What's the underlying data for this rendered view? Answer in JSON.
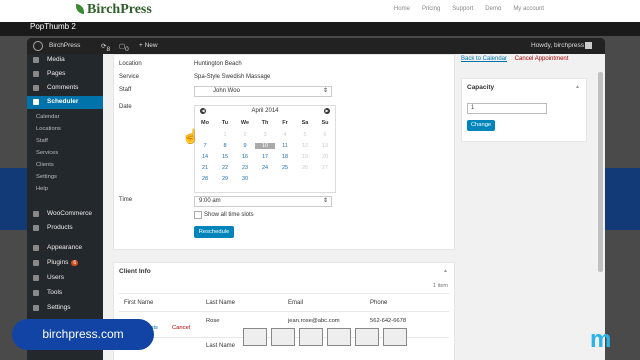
{
  "site": {
    "logo": "BirchPress",
    "nav": [
      "Home",
      "Pricing",
      "Support",
      "Demo",
      "My account"
    ]
  },
  "video_title": "PopThumb 2",
  "admin_bar": {
    "site_name": "BirchPress",
    "updates": "8",
    "comments": "0",
    "new_label": "+ New",
    "howdy": "Howdy, birchpress"
  },
  "menu": {
    "items": [
      {
        "label": "Media",
        "icon": "media-icon"
      },
      {
        "label": "Pages",
        "icon": "pages-icon"
      },
      {
        "label": "Comments",
        "icon": "comments-icon"
      },
      {
        "label": "Scheduler",
        "icon": "calendar-icon"
      }
    ],
    "submenu": [
      "Calendar",
      "Locations",
      "Staff",
      "Services",
      "Clients",
      "Settings",
      "Help"
    ],
    "items2": [
      {
        "label": "WooCommerce",
        "icon": "woo-icon"
      },
      {
        "label": "Products",
        "icon": "products-icon"
      },
      {
        "label": "Appearance",
        "icon": "appearance-icon"
      },
      {
        "label": "Plugins",
        "icon": "plugins-icon"
      },
      {
        "label": "Users",
        "icon": "users-icon"
      },
      {
        "label": "Tools",
        "icon": "tools-icon"
      },
      {
        "label": "Settings",
        "icon": "settings-icon"
      }
    ],
    "plugins_badge": "6"
  },
  "form": {
    "location_label": "Location",
    "location_value": "Huntington Beach",
    "service_label": "Service",
    "service_value": "Spa-Style Swedish Massage",
    "staff_label": "Staff",
    "staff_value": "John Woo",
    "date_label": "Date",
    "time_label": "Time",
    "time_value": "9:00 am",
    "all_slots_label": "Show all time slots",
    "reschedule_label": "Reschedule"
  },
  "calendar": {
    "title": "April 2014",
    "day_names": [
      "Mo",
      "Tu",
      "We",
      "Th",
      "Fr",
      "Sa",
      "Su"
    ],
    "weeks": [
      [
        "",
        "1",
        "2",
        "3",
        "4",
        "5",
        "6"
      ],
      [
        "7",
        "8",
        "9",
        "10",
        "11",
        "12",
        "13"
      ],
      [
        "14",
        "15",
        "16",
        "17",
        "18",
        "19",
        "20"
      ],
      [
        "21",
        "22",
        "23",
        "24",
        "25",
        "26",
        "27"
      ],
      [
        "28",
        "29",
        "30",
        "",
        "",
        "",
        ""
      ]
    ],
    "disabled": [
      "1",
      "2",
      "3",
      "4",
      "5",
      "6",
      "12",
      "13",
      "19",
      "20",
      "26",
      "27"
    ],
    "selected": "10"
  },
  "actions": {
    "back_label": "Back to Calendar",
    "cancel_label": "Cancel Appointment"
  },
  "capacity": {
    "title": "Capacity",
    "value": "1",
    "change_label": "Change"
  },
  "client": {
    "title": "Client Info",
    "count": "1 item",
    "headers": [
      "First Name",
      "Last Name",
      "Email",
      "Phone"
    ],
    "row": {
      "first": "",
      "last": "Rose",
      "email": "jean.rose@abc.com",
      "phone": "562-642-6678",
      "edit": "ents",
      "cancel": "Cancel"
    },
    "row2_last_header": "Last Name"
  },
  "overlay": {
    "pill_text": "birchpress.com",
    "logo_text": "m"
  }
}
